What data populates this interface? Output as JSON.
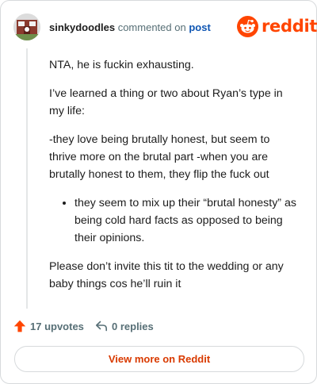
{
  "header": {
    "username": "sinkydoodles",
    "action": "commented on",
    "post_link": "post",
    "brand_name": "reddit",
    "avatar_icon": "user-avatar",
    "brand_icon": "reddit-snoo-icon"
  },
  "comment": {
    "paragraph_1": "NTA, he is fuckin exhausting.",
    "paragraph_2": "I’ve learned a thing or two about Ryan’s type in my life:",
    "paragraph_3": "-they love being brutally honest, but seem to thrive more on the brutal part -when you are brutally honest to them, they flip the fuck out",
    "bullets": [
      "they seem to mix up their “brutal honesty” as being cold hard facts as opposed to being their opinions."
    ],
    "paragraph_4": "Please don’t invite this tit to the wedding or any baby things cos he’ll ruin it"
  },
  "footer": {
    "upvotes": "17 upvotes",
    "replies": "0 replies",
    "upvote_icon": "upvote-arrow-icon",
    "reply_icon": "reply-icon"
  },
  "view_button": "View more on Reddit",
  "colors": {
    "accent": "#ff4500",
    "button_text": "#d93a00",
    "link": "#0f56b3",
    "muted": "#576f76",
    "border": "#d7dadc"
  }
}
